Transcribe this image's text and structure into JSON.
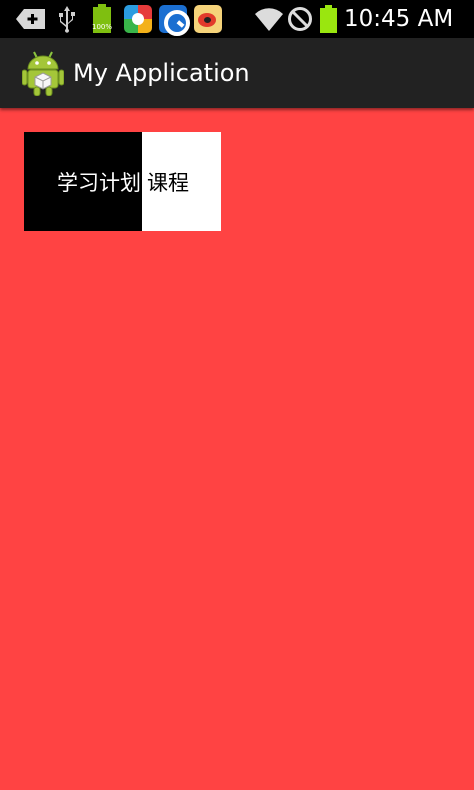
{
  "status_bar": {
    "time": "10:45 AM",
    "battery_label": "100%",
    "icons": [
      "notification-add-icon",
      "usb-icon",
      "battery-small-icon",
      "app-icon",
      "search-app-icon",
      "weibo-icon",
      "wifi-icon",
      "no-signal-icon",
      "battery-icon"
    ],
    "battery_color": "#9ae60f"
  },
  "action_bar": {
    "title": "My Application",
    "logo_icon": "android-icon",
    "background": "#222222"
  },
  "tabs": [
    {
      "label": "学习计划",
      "selected": true
    },
    {
      "label": "课程",
      "selected": false
    }
  ],
  "colors": {
    "page_background": "#ff4343",
    "tab_selected_bg": "#000000",
    "tab_unselected_bg": "#ffffff"
  }
}
